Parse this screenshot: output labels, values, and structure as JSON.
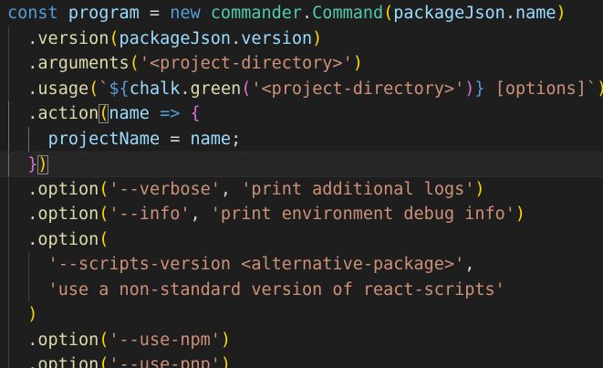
{
  "colors": {
    "background": "#1e1e1e",
    "keyword": "#569cd6",
    "variable": "#9cdcfe",
    "function": "#dcdcaa",
    "class": "#4ec9b0",
    "string": "#ce9178",
    "punctuation": "#d4d4d4",
    "bracket_gold": "#ffd700",
    "bracket_purple": "#da70d6",
    "bracket_blue": "#179fff",
    "template_brace": "#569cd6"
  },
  "lines": [
    [
      {
        "t": "const ",
        "c": "keyword"
      },
      {
        "t": "program",
        "c": "variable"
      },
      {
        "t": " = ",
        "c": "punctuation"
      },
      {
        "t": "new ",
        "c": "keyword"
      },
      {
        "t": "commander",
        "c": "class"
      },
      {
        "t": ".",
        "c": "punctuation"
      },
      {
        "t": "Command",
        "c": "class"
      },
      {
        "t": "(",
        "c": "bracket_gold"
      },
      {
        "t": "packageJson",
        "c": "variable"
      },
      {
        "t": ".",
        "c": "punctuation"
      },
      {
        "t": "name",
        "c": "variable"
      },
      {
        "t": ")",
        "c": "bracket_gold"
      }
    ],
    [
      {
        "t": "  .",
        "c": "punctuation"
      },
      {
        "t": "version",
        "c": "function"
      },
      {
        "t": "(",
        "c": "bracket_gold"
      },
      {
        "t": "packageJson",
        "c": "variable"
      },
      {
        "t": ".",
        "c": "punctuation"
      },
      {
        "t": "version",
        "c": "variable"
      },
      {
        "t": ")",
        "c": "bracket_gold"
      }
    ],
    [
      {
        "t": "  .",
        "c": "punctuation"
      },
      {
        "t": "arguments",
        "c": "function"
      },
      {
        "t": "(",
        "c": "bracket_gold"
      },
      {
        "t": "'<project-directory>'",
        "c": "string"
      },
      {
        "t": ")",
        "c": "bracket_gold"
      }
    ],
    [
      {
        "t": "  .",
        "c": "punctuation"
      },
      {
        "t": "usage",
        "c": "function"
      },
      {
        "t": "(",
        "c": "bracket_gold"
      },
      {
        "t": "`",
        "c": "string"
      },
      {
        "t": "${",
        "c": "template_brace"
      },
      {
        "t": "chalk",
        "c": "variable"
      },
      {
        "t": ".",
        "c": "punctuation"
      },
      {
        "t": "green",
        "c": "function"
      },
      {
        "t": "(",
        "c": "bracket_purple"
      },
      {
        "t": "'<project-directory>'",
        "c": "string"
      },
      {
        "t": ")",
        "c": "bracket_purple"
      },
      {
        "t": "}",
        "c": "template_brace"
      },
      {
        "t": " [options]`",
        "c": "string"
      },
      {
        "t": ")",
        "c": "bracket_gold"
      }
    ],
    [
      {
        "t": "  .",
        "c": "punctuation"
      },
      {
        "t": "action",
        "c": "function"
      },
      {
        "t": "(",
        "c": "bracket_gold",
        "box": true
      },
      {
        "t": "name",
        "c": "variable"
      },
      {
        "t": " ",
        "c": "punctuation"
      },
      {
        "t": "=>",
        "c": "keyword"
      },
      {
        "t": " ",
        "c": "punctuation"
      },
      {
        "t": "{",
        "c": "bracket_purple"
      }
    ],
    [
      {
        "t": "    ",
        "c": "punctuation"
      },
      {
        "t": "projectName",
        "c": "variable"
      },
      {
        "t": " = ",
        "c": "punctuation"
      },
      {
        "t": "name",
        "c": "variable"
      },
      {
        "t": ";",
        "c": "punctuation"
      }
    ],
    [
      {
        "t": "  ",
        "c": "punctuation"
      },
      {
        "t": "}",
        "c": "bracket_purple"
      },
      {
        "t": ")",
        "c": "bracket_gold",
        "box": true
      }
    ],
    [
      {
        "t": "  .",
        "c": "punctuation"
      },
      {
        "t": "option",
        "c": "function"
      },
      {
        "t": "(",
        "c": "bracket_gold"
      },
      {
        "t": "'--verbose'",
        "c": "string"
      },
      {
        "t": ", ",
        "c": "punctuation"
      },
      {
        "t": "'print additional logs'",
        "c": "string"
      },
      {
        "t": ")",
        "c": "bracket_gold"
      }
    ],
    [
      {
        "t": "  .",
        "c": "punctuation"
      },
      {
        "t": "option",
        "c": "function"
      },
      {
        "t": "(",
        "c": "bracket_gold"
      },
      {
        "t": "'--info'",
        "c": "string"
      },
      {
        "t": ", ",
        "c": "punctuation"
      },
      {
        "t": "'print environment debug info'",
        "c": "string"
      },
      {
        "t": ")",
        "c": "bracket_gold"
      }
    ],
    [
      {
        "t": "  .",
        "c": "punctuation"
      },
      {
        "t": "option",
        "c": "function"
      },
      {
        "t": "(",
        "c": "bracket_gold"
      }
    ],
    [
      {
        "t": "    ",
        "c": "punctuation"
      },
      {
        "t": "'--scripts-version <alternative-package>'",
        "c": "string"
      },
      {
        "t": ",",
        "c": "punctuation"
      }
    ],
    [
      {
        "t": "    ",
        "c": "punctuation"
      },
      {
        "t": "'use a non-standard version of react-scripts'",
        "c": "string"
      }
    ],
    [
      {
        "t": "  ",
        "c": "punctuation"
      },
      {
        "t": ")",
        "c": "bracket_gold"
      }
    ],
    [
      {
        "t": "  .",
        "c": "punctuation"
      },
      {
        "t": "option",
        "c": "function"
      },
      {
        "t": "(",
        "c": "bracket_gold"
      },
      {
        "t": "'--use-npm'",
        "c": "string"
      },
      {
        "t": ")",
        "c": "bracket_gold"
      }
    ],
    [
      {
        "t": "  .",
        "c": "punctuation"
      },
      {
        "t": "option",
        "c": "function"
      },
      {
        "t": "(",
        "c": "bracket_gold"
      },
      {
        "t": "'--use-pnp'",
        "c": "string"
      },
      {
        "t": ")",
        "c": "bracket_gold"
      }
    ]
  ]
}
